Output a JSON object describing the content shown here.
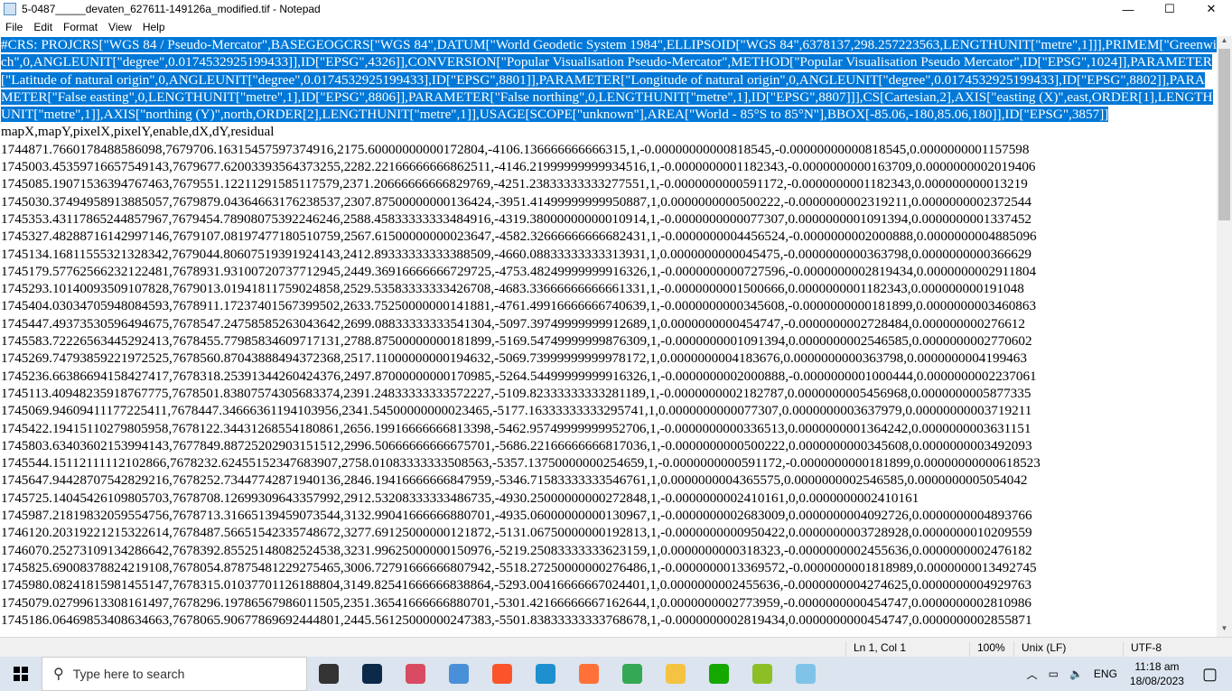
{
  "window": {
    "title": "5-0487_____devaten_627611-149126a_modified.tif - Notepad",
    "minimize": "—",
    "maximize": "☐",
    "close": "✕"
  },
  "menu": [
    "File",
    "Edit",
    "Format",
    "View",
    "Help"
  ],
  "editor": {
    "crs_text": "#CRS: PROJCRS[\"WGS 84 / Pseudo-Mercator\",BASEGEOGCRS[\"WGS 84\",DATUM[\"World Geodetic System 1984\",ELLIPSOID[\"WGS 84\",6378137,298.257223563,LENGTHUNIT[\"metre\",1]]],PRIMEM[\"Greenwich\",0,ANGLEUNIT[\"degree\",0.0174532925199433]],ID[\"EPSG\",4326]],CONVERSION[\"Popular Visualisation Pseudo-Mercator\",METHOD[\"Popular Visualisation Pseudo Mercator\",ID[\"EPSG\",1024]],PARAMETER[\"Latitude of natural origin\",0,ANGLEUNIT[\"degree\",0.0174532925199433],ID[\"EPSG\",8801]],PARAMETER[\"Longitude of natural origin\",0,ANGLEUNIT[\"degree\",0.0174532925199433],ID[\"EPSG\",8802]],PARAMETER[\"False easting\",0,LENGTHUNIT[\"metre\",1],ID[\"EPSG\",8806]],PARAMETER[\"False northing\",0,LENGTHUNIT[\"metre\",1],ID[\"EPSG\",8807]]],CS[Cartesian,2],AXIS[\"easting (X)\",east,ORDER[1],LENGTHUNIT[\"metre\",1]],AXIS[\"northing (Y)\",north,ORDER[2],LENGTHUNIT[\"metre\",1]],USAGE[SCOPE[\"unknown\"],AREA[\"World - 85°S to 85°N\"],BBOX[-85.06,-180,85.06,180]],ID[\"EPSG\",3857]]",
    "header": "mapX,mapY,pixelX,pixelY,enable,dX,dY,residual",
    "rows": [
      "1744871.7660178488586098,7679706.16315457597374916,2175.60000000000172804,-4106.136666666666315,1,-0.00000000000818545,-0.00000000000818545,0.0000000001157598",
      "1745003.45359716657549143,7679677.62003393564373255,2282.22166666666862511,-4146.21999999999934516,1,-0.0000000001182343,-0.0000000000163709,0.0000000002019406",
      "1745085.19071536394767463,7679551.12211291585117579,2371.20666666666829769,-4251.23833333333277551,1,-0.0000000000591172,-0.0000000001182343,0.000000000013219",
      "1745030.37494958913885057,7679879.04364663176238537,2307.87500000000136424,-3951.41499999999950887,1,0.0000000000500222,-0.0000000002319211,0.0000000002372544",
      "1745353.43117865244857967,7679454.78908075392246246,2588.45833333333484916,-4319.38000000000010914,1,-0.0000000000077307,0.0000000001091394,0.0000000001337452",
      "1745327.48288716142997146,7679107.08197477180510759,2567.61500000000023647,-4582.32666666666682431,1,-0.0000000004456524,-0.0000000002000888,0.0000000004885096",
      "1745134.16811555321328342,7679044.80607519391924143,2412.89333333333388509,-4660.08833333333313931,1,0.0000000000045475,-0.0000000000363798,0.0000000000366629",
      "1745179.57762566232122481,7678931.93100720737712945,2449.36916666666729725,-4753.48249999999916326,1,-0.0000000000727596,-0.0000000002819434,0.0000000002911804",
      "1745293.10140093509107828,7679013.01941811759024858,2529.53583333333426708,-4683.33666666666661331,1,-0.0000000001500666,0.0000000001182343,0.000000000191048",
      "1745404.03034705948084593,7678911.17237401567399502,2633.75250000000141881,-4761.49916666666740639,1,-0.0000000000345608,-0.0000000000181899,0.0000000003460863",
      "1745447.49373530596494675,7678547.24758585263043642,2699.08833333333541304,-5097.39749999999912689,1,0.0000000000454747,-0.0000000002728484,0.000000000276612",
      "1745583.72226563445292413,7678455.77985834609717131,2788.87500000000181899,-5169.54749999999876309,1,-0.0000000001091394,0.0000000002546585,0.0000000002770602",
      "1745269.74793859221972525,7678560.87043888494372368,2517.11000000000194632,-5069.73999999999978172,1,0.0000000004183676,0.0000000000363798,0.0000000004199463",
      "1745236.66386694158427417,7678318.25391344260424376,2497.87000000000170985,-5264.54499999999916326,1,-0.0000000002000888,-0.0000000001000444,0.0000000002237061",
      "1745113.40948235918767775,7678501.83807574305683374,2391.24833333333572227,-5109.82333333333281189,1,-0.0000000002182787,0.0000000005456968,0.0000000005877335",
      "1745069.94609411177225411,7678447.34666361194103956,2341.54500000000023465,-5177.16333333333295741,1,0.0000000000077307,0.0000000003637979,0.00000000003719211",
      "1745422.19415110279805958,7678122.34431268554180861,2656.19916666666813398,-5462.95749999999952706,1,-0.0000000000336513,0.0000000001364242,0.0000000003631151",
      "1745803.63403602153994143,7677849.88725202903151512,2996.50666666666675701,-5686.22166666666817036,1,-0.0000000000500222,0.0000000000345608,0.0000000003492093",
      "1745544.15112111112102866,7678232.62455152347683907,2758.01083333333508563,-5357.13750000000254659,1,-0.0000000000591172,-0.0000000000181899,0.00000000000618523",
      "1745647.94428707542829216,7678252.73447742871940136,2846.19416666666847959,-5346.71583333333546761,1,0.0000000004365575,0.0000000002546585,0.0000000005054042",
      "1745725.14045426109805703,7678708.12699309643357992,2912.53208333333486735,-4930.25000000000272848,1,-0.0000000002410161,0,0.0000000002410161",
      "1745987.21819832059554756,7678713.31665139459073544,3132.99041666666880701,-4935.06000000000130967,1,-0.0000000002683009,0.0000000004092726,0.0000000004893766",
      "1746120.20319221215322614,7678487.56651542335748672,3277.69125000000121872,-5131.06750000000192813,1,-0.0000000000950422,0.0000000003728928,0.0000000010209559",
      "1746070.25273109134286642,7678392.85525148082524538,3231.99625000000150976,-5219.25083333333623159,1,0.0000000000318323,-0.0000000002455636,0.0000000002476182",
      "1745825.69008378824219108,7678054.87875481229275465,3006.72791666666807942,-5518.27250000000276486,1,-0.0000000013369572,-0.0000000001818989,0.0000000013492745",
      "1745980.08241815981455147,7678315.01037701126188804,3149.82541666666838864,-5293.00416666667024401,1,0.0000000002455636,-0.0000000004274625,0.0000000004929763",
      "1745079.02799613308161497,7678296.19786567986011505,2351.36541666666880701,-5301.42166666667162644,1,0.0000000002773959,-0.0000000000454747,0.0000000002810986",
      "1745186.06469853408634663,7678065.90677869692444801,2445.56125000000247383,-5501.83833333333768678,1,-0.0000000002819434,0.0000000000454747,0.0000000002855871"
    ]
  },
  "statusbar": {
    "position": "Ln 1, Col 1",
    "zoom": "100%",
    "line_ending": "Unix (LF)",
    "encoding": "UTF-8"
  },
  "taskbar": {
    "search_placeholder": "Type here to search",
    "apps": [
      {
        "icon": "task-view-icon",
        "color": "#333333"
      },
      {
        "icon": "photoshop-icon",
        "color": "#0b2a4a"
      },
      {
        "icon": "snipping-icon",
        "color": "#d94b62"
      },
      {
        "icon": "laptop-app-icon",
        "color": "#4a90d9"
      },
      {
        "icon": "brave-icon",
        "color": "#fb542b"
      },
      {
        "icon": "edge-icon",
        "color": "#1e90d0"
      },
      {
        "icon": "firefox-icon",
        "color": "#ff7139"
      },
      {
        "icon": "chrome-icon",
        "color": "#34a853"
      },
      {
        "icon": "file-explorer-icon",
        "color": "#f5c342"
      },
      {
        "icon": "upwork-icon",
        "color": "#14a800"
      },
      {
        "icon": "qgis-icon",
        "color": "#8cbf26"
      },
      {
        "icon": "notepad-icon",
        "color": "#7fc3e8"
      }
    ],
    "tray": {
      "language": "ENG",
      "time": "11:18 am",
      "date": "18/08/2023"
    }
  }
}
